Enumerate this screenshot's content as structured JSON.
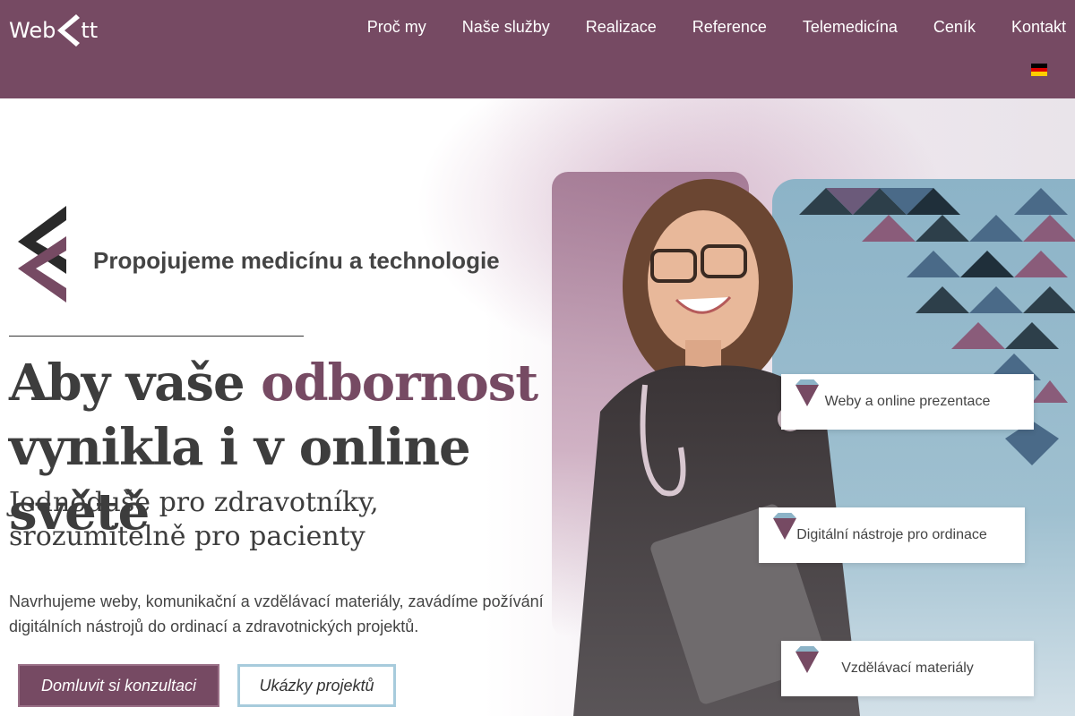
{
  "header": {
    "logo_text_left": "Web",
    "logo_text_right": "tt",
    "nav": [
      "Proč my",
      "Naše služby",
      "Realizace",
      "Reference",
      "Telemedicína",
      "Ceník",
      "Kontakt"
    ],
    "language_flag": "german-flag-icon",
    "colors": {
      "background": "#764a63",
      "text": "#ffffff"
    }
  },
  "hero": {
    "tagline": "Propojujeme medicínu a technologie",
    "headline_part1": "Aby vaše ",
    "headline_accent": "odbornost",
    "headline_part2": "vynikla i v online světě",
    "subheadline_line1": "Jednoduše pro zdravotníky,",
    "subheadline_line2": "srozumitelně pro pacienty",
    "description": "Navrhujeme weby, komunikační a vzdělávací materiály, zavádíme požívání digitálních nástrojů do ordinací a zdravotnických projektů.",
    "primary_button": "Domluvit si konzultaci",
    "secondary_button": "Ukázky projektů",
    "colors": {
      "accent": "#764a63",
      "secondary_border": "#a7cbdc"
    }
  },
  "features": [
    {
      "label": "Weby a online prezentace"
    },
    {
      "label": "Digitální nástroje pro ordinace"
    },
    {
      "label": "Vzdělávací materiály"
    }
  ]
}
